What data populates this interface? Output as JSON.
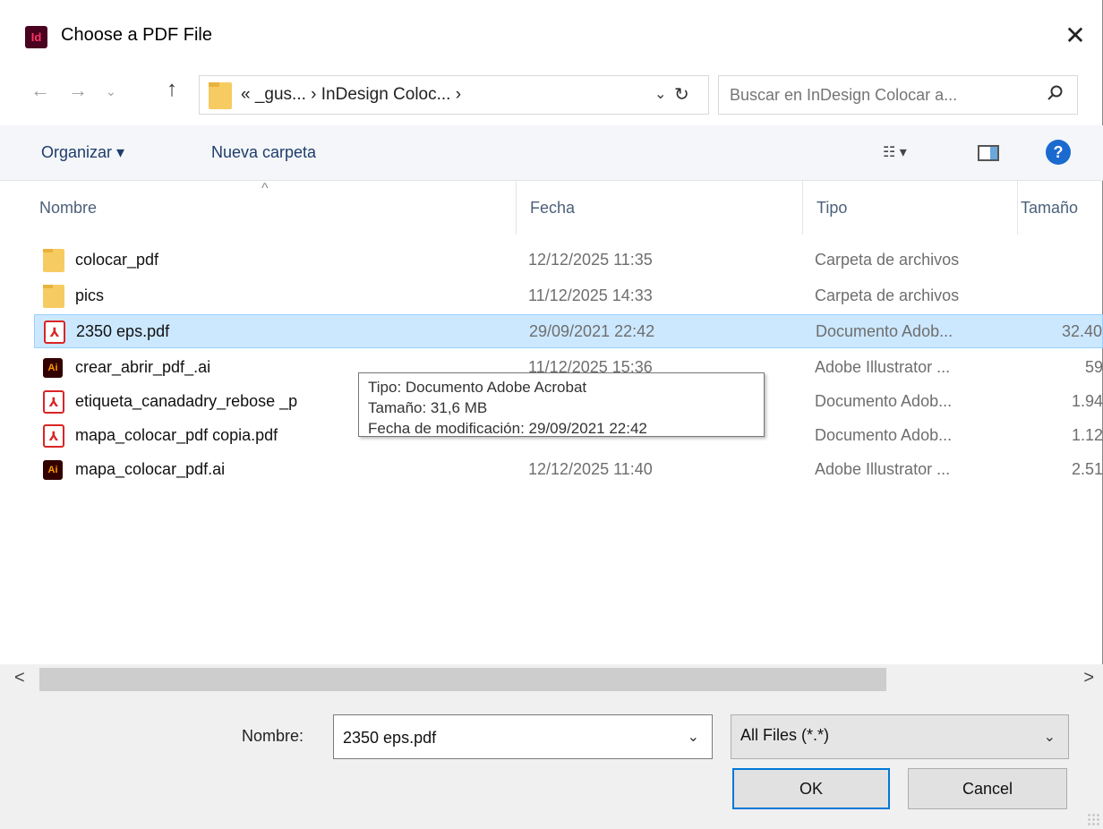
{
  "window": {
    "title": "Choose a PDF File",
    "app_icon_label": "Id",
    "close_glyph": "✕"
  },
  "nav": {
    "back": "←",
    "forward": "→",
    "recent": "⌄",
    "up": "↑",
    "breadcrumb": "«  _gus...  ›  InDesign Coloc...  ›",
    "address_dropdown": "⌄",
    "refresh": "↻"
  },
  "search": {
    "placeholder": "Buscar en InDesign Colocar a..."
  },
  "toolbar": {
    "organize": "Organizar ▾",
    "new_folder": "Nueva carpeta",
    "view_glyph": "☷ ▾",
    "help": "?"
  },
  "columns": {
    "name": "Nombre",
    "date": "Fecha",
    "type": "Tipo",
    "size": "Tamaño",
    "sort_indicator": "^"
  },
  "files": [
    {
      "icon": "folder-icon",
      "name": "colocar_pdf",
      "date": "12/12/2025 11:35",
      "type": "Carpeta de archivos",
      "size": ""
    },
    {
      "icon": "folder-icon",
      "name": "pics",
      "date": "11/12/2025 14:33",
      "type": "Carpeta de archivos",
      "size": ""
    },
    {
      "icon": "pdf-icon",
      "name": "2350 eps.pdf",
      "date": "29/09/2021 22:42",
      "type": "Documento Adob...",
      "size": "32.40",
      "selected": true
    },
    {
      "icon": "illustrator-icon",
      "name": "crear_abrir_pdf_.ai",
      "date": "11/12/2025 15:36",
      "type": "Adobe Illustrator ...",
      "size": "59"
    },
    {
      "icon": "pdf-icon",
      "name": "etiqueta_canadadry_rebose _p",
      "date": "",
      "type": "Documento Adob...",
      "size": "1.94"
    },
    {
      "icon": "pdf-icon",
      "name": "mapa_colocar_pdf copia.pdf",
      "date": "",
      "type": "Documento Adob...",
      "size": "1.12"
    },
    {
      "icon": "illustrator-icon",
      "name": "mapa_colocar_pdf.ai",
      "date": "12/12/2025 11:40",
      "type": "Adobe Illustrator ...",
      "size": "2.51"
    }
  ],
  "tooltip": {
    "type_line": "Tipo: Documento Adobe Acrobat",
    "size_line": "Tamaño: 31,6 MB",
    "date_line": "Fecha de modificación: 29/09/2021 22:42"
  },
  "scrollbar": {
    "left": "<",
    "right": ">"
  },
  "bottom": {
    "filename_label": "Nombre:",
    "filename_value": "2350 eps.pdf",
    "filter_value": "All Files (*.*)",
    "dropdown_glyph": "⌄",
    "ok_label": "OK",
    "cancel_label": "Cancel"
  },
  "colors": {
    "selection": "#cce8ff",
    "accent": "#0078d7"
  }
}
